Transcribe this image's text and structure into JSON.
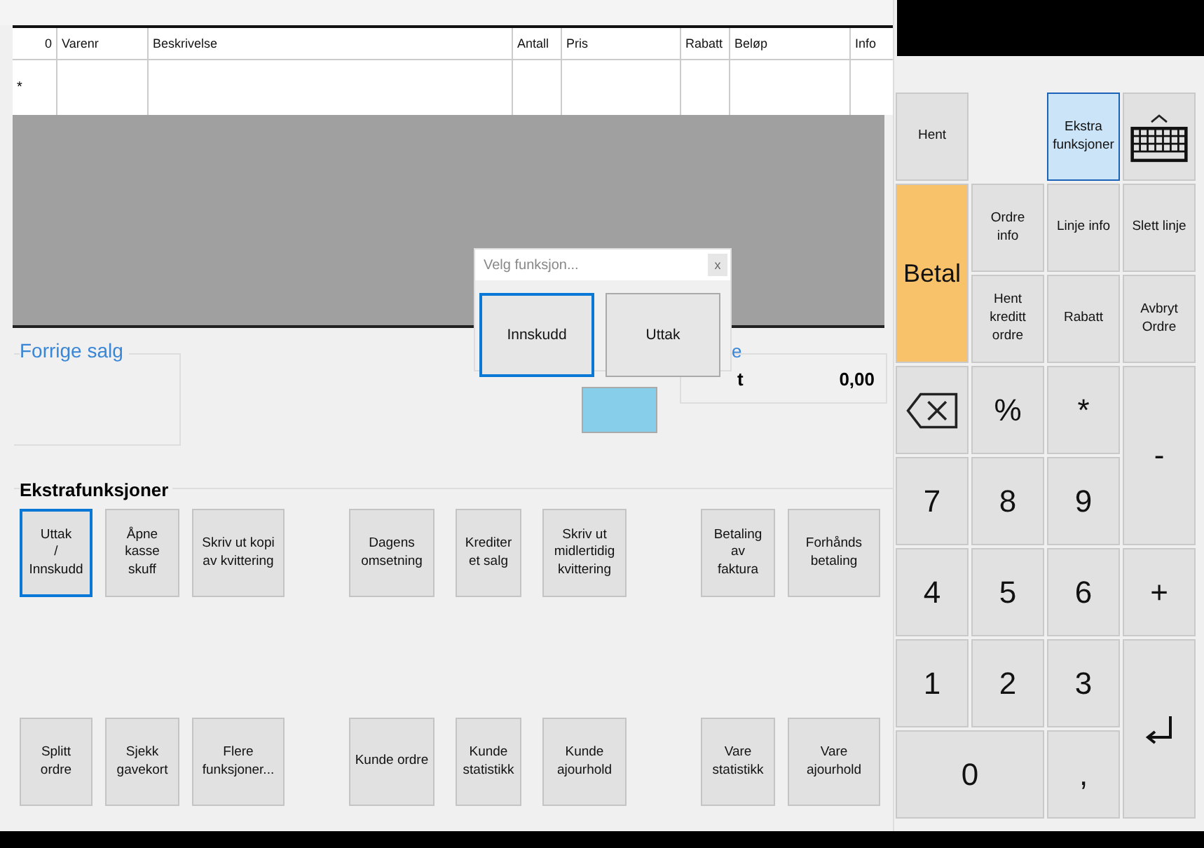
{
  "order_table": {
    "columns": [
      "0",
      "Varenr",
      "Beskrivelse",
      "Antall",
      "Pris",
      "Rabatt",
      "Beløp",
      "Info"
    ],
    "rows": [
      {
        "marker": "*"
      }
    ]
  },
  "previous_sale": {
    "title": "Forrige salg"
  },
  "totals": {
    "title_fragment": "e",
    "label_fragment": "t",
    "amount": "0,00"
  },
  "extra_functions": {
    "title": "Ekstrafunksjoner",
    "rows": [
      [
        [
          {
            "label": "Uttak\n/\nInnskudd",
            "selected": true
          },
          {
            "label": "Åpne\nkasse\nskuff",
            "selected": false
          },
          {
            "label": "Skriv ut kopi\nav kvittering",
            "selected": false
          }
        ],
        [
          {
            "label": "Dagens\nomsetning",
            "selected": false
          },
          {
            "label": "Krediter\net salg",
            "selected": false
          },
          {
            "label": "Skriv ut\nmidlertidig\nkvittering",
            "selected": false
          }
        ],
        [
          {
            "label": "Betaling\nav\nfaktura",
            "selected": false
          },
          {
            "label": "Forhånds\nbetaling",
            "selected": false
          }
        ]
      ],
      [
        [
          {
            "label": "Splitt\nordre",
            "selected": false
          },
          {
            "label": "Sjekk\ngavekort",
            "selected": false
          },
          {
            "label": "Flere\nfunksjoner...",
            "selected": false
          }
        ],
        [
          {
            "label": "Kunde ordre",
            "selected": false
          },
          {
            "label": "Kunde\nstatistikk",
            "selected": false
          },
          {
            "label": "Kunde\najourhold",
            "selected": false
          }
        ],
        [
          {
            "label": "Vare\nstatistikk",
            "selected": false
          },
          {
            "label": "Vare\najourhold",
            "selected": false
          }
        ]
      ]
    ]
  },
  "dialog": {
    "title": "Velg funksjon...",
    "close": "x",
    "buttons": [
      {
        "label": "Innskudd",
        "selected": true
      },
      {
        "label": "Uttak",
        "selected": false
      }
    ]
  },
  "keypad": [
    {
      "kind": "text",
      "label": "Hent",
      "selected": false
    },
    {
      "kind": "text",
      "label": "Ekstra\nfunksjoner",
      "selected": true
    },
    {
      "kind": "keyboard",
      "selected": false
    },
    {
      "kind": "pay",
      "label": "Betal",
      "selected": false
    },
    {
      "kind": "text",
      "label": "Ordre\ninfo",
      "selected": false
    },
    {
      "kind": "text",
      "label": "Linje info",
      "selected": false
    },
    {
      "kind": "text",
      "label": "Slett linje",
      "selected": false
    },
    {
      "kind": "text",
      "label": "Hent\nkreditt\nordre",
      "selected": false
    },
    {
      "kind": "text",
      "label": "Rabatt",
      "selected": false
    },
    {
      "kind": "text",
      "label": "Avbryt\nOrdre",
      "selected": false
    },
    {
      "kind": "backspace",
      "selected": false
    },
    {
      "kind": "digit",
      "label": "%",
      "selected": false
    },
    {
      "kind": "digit",
      "label": "*",
      "selected": false
    },
    {
      "kind": "digit",
      "label": "-",
      "selected": false
    },
    {
      "kind": "digit",
      "label": "7",
      "selected": false
    },
    {
      "kind": "digit",
      "label": "8",
      "selected": false
    },
    {
      "kind": "digit",
      "label": "9",
      "selected": false
    },
    {
      "kind": "digit",
      "label": "4",
      "selected": false
    },
    {
      "kind": "digit",
      "label": "5",
      "selected": false
    },
    {
      "kind": "digit",
      "label": "6",
      "selected": false
    },
    {
      "kind": "digit",
      "label": "+",
      "selected": false
    },
    {
      "kind": "digit",
      "label": "1",
      "selected": false
    },
    {
      "kind": "digit",
      "label": "2",
      "selected": false
    },
    {
      "kind": "digit",
      "label": "3",
      "selected": false
    },
    {
      "kind": "enter",
      "selected": false
    },
    {
      "kind": "digit",
      "label": "0",
      "selected": false
    },
    {
      "kind": "digit",
      "label": ",",
      "selected": false
    }
  ]
}
